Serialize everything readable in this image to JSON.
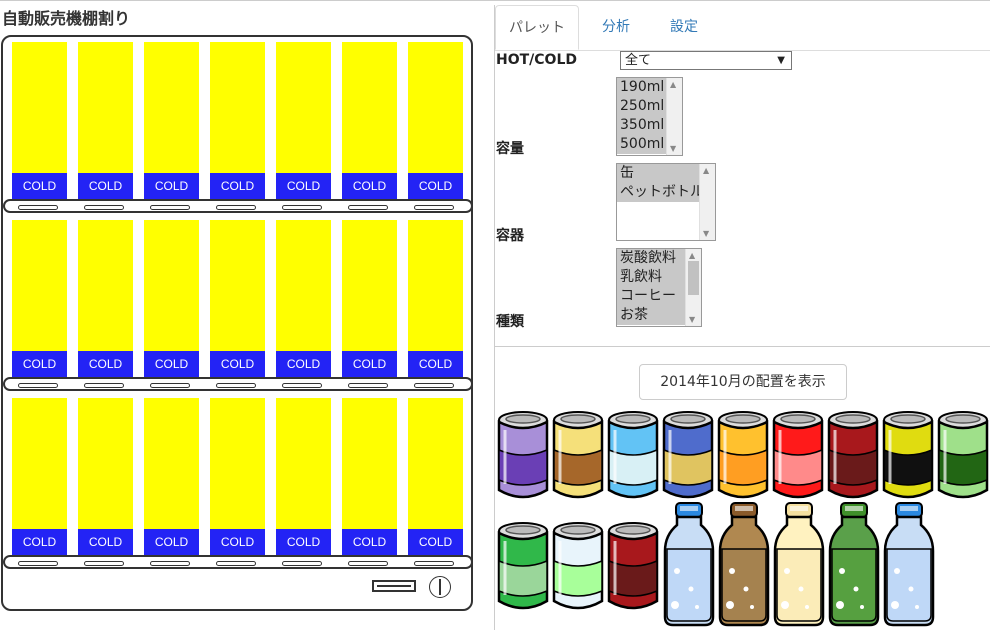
{
  "page_title": "自動販売機棚割り",
  "machine": {
    "rows": [
      {
        "slots": [
          "COLD",
          "COLD",
          "COLD",
          "COLD",
          "COLD",
          "COLD",
          "COLD"
        ]
      },
      {
        "slots": [
          "COLD",
          "COLD",
          "COLD",
          "COLD",
          "COLD",
          "COLD",
          "COLD"
        ]
      },
      {
        "slots": [
          "COLD",
          "COLD",
          "COLD",
          "COLD",
          "COLD",
          "COLD",
          "COLD"
        ]
      }
    ],
    "slot_color": "#ffff00",
    "label_color": "#2323f5"
  },
  "tabs": [
    "パレット",
    "分析",
    "設定"
  ],
  "filters": {
    "hotcold": {
      "label": "HOT/COLD",
      "value": "全て"
    },
    "volume": {
      "label": "容量",
      "options": [
        "190ml",
        "250ml",
        "350ml",
        "500ml"
      ]
    },
    "container": {
      "label": "容器",
      "options": [
        "缶",
        "ペットボトル"
      ]
    },
    "category": {
      "label": "種類",
      "options": [
        "炭酸飲料",
        "乳飲料",
        "コーヒー",
        "お茶"
      ]
    }
  },
  "show_button": "2014年10月の配置を表示",
  "palette": {
    "cans_row1": [
      {
        "body": "#a88fd8",
        "label": "#6a3fb5"
      },
      {
        "body": "#f5e07a",
        "label": "#a6672a"
      },
      {
        "body": "#62c3f5",
        "label": "#d8f0f5"
      },
      {
        "body": "#4f6ccc",
        "label": "#e0c460"
      },
      {
        "body": "#ffc12e",
        "label": "#ff9e22"
      },
      {
        "body": "#ff1a1a",
        "label": "#ff8a8a"
      },
      {
        "body": "#a8181c",
        "label": "#6a1a1a"
      },
      {
        "body": "#e0dc10",
        "label": "#101010"
      },
      {
        "body": "#9fe08a",
        "label": "#226614"
      }
    ],
    "cans_row2": [
      {
        "body": "#30b84a",
        "label": "#9ad69a"
      },
      {
        "body": "#e8f4fb",
        "label": "#a8ff9a"
      },
      {
        "body": "#a8181c",
        "label": "#6a1a1a"
      }
    ],
    "bottles": [
      {
        "cap": "#2a88e0",
        "body": "#c8ddf5",
        "liquid": "#bfd8f7"
      },
      {
        "cap": "#8a5a2a",
        "body": "#b08850",
        "liquid": "#a5824f"
      },
      {
        "cap": "#f5e0a0",
        "body": "#fff2c0",
        "liquid": "#fbecb8"
      },
      {
        "cap": "#3f8f2a",
        "body": "#5aa04a",
        "liquid": "#56a040"
      },
      {
        "cap": "#2a88e0",
        "body": "#c8ddf5",
        "liquid": "#bfd8f7"
      }
    ]
  }
}
